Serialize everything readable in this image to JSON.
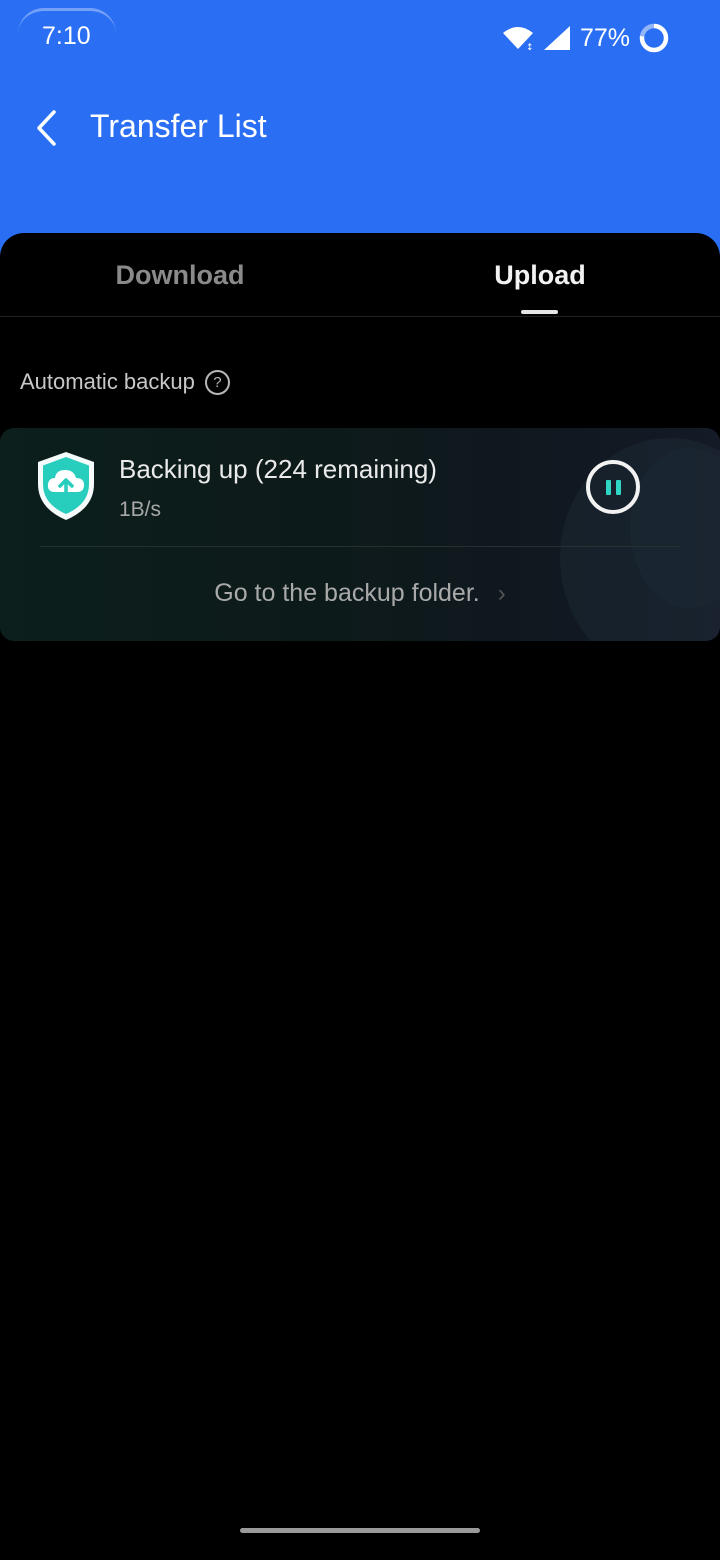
{
  "status_bar": {
    "time": "7:10",
    "battery": "77%",
    "icons": [
      "wifi-icon",
      "signal-icon",
      "battery-ring-icon"
    ]
  },
  "header": {
    "title": "Transfer List",
    "back_icon": "chevron-left-icon",
    "background_color": "#2a6ff3"
  },
  "tabs": [
    {
      "label": "Download",
      "selected": false
    },
    {
      "label": "Upload",
      "selected": true
    }
  ],
  "section": {
    "label": "Automatic backup",
    "help_icon": "question-circle-icon"
  },
  "backup_card": {
    "title": "Backing up (224 remaining)",
    "speed": "1B/s",
    "icon": "cloud-upload-shield-icon",
    "action_icon": "pause-icon",
    "link_text": "Go to the backup folder.",
    "accent_color": "#2fd6c4"
  }
}
